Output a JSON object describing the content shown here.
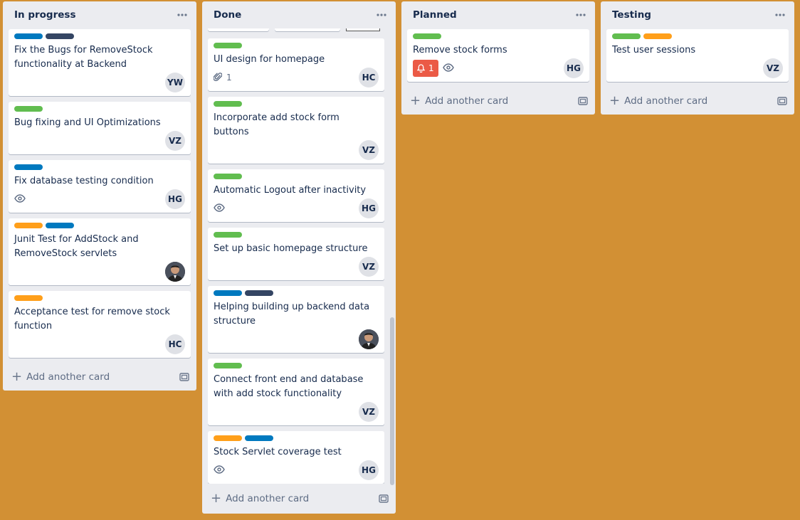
{
  "colors": {
    "board_bg": "#d29034",
    "list_bg": "#ebecf0",
    "label_blue": "#0079bf",
    "label_dark": "#344563",
    "label_green": "#61bd4f",
    "label_orange": "#ff9f1a",
    "badge_red": "#eb5a46"
  },
  "add_card_label": "Add another card",
  "lists": [
    {
      "title": "In progress",
      "cards": [
        {
          "labels": [
            "blue",
            "dark"
          ],
          "title": "Fix the Bugs for RemoveStock functionality at Backend",
          "avatar": "YW"
        },
        {
          "labels": [
            "green"
          ],
          "title": "Bug fixing and UI Optimizations",
          "avatar": "VZ"
        },
        {
          "labels": [
            "blue"
          ],
          "title": "Fix database testing condition",
          "watch": true,
          "avatar": "HG"
        },
        {
          "labels": [
            "orange",
            "blue"
          ],
          "title": "Junit Test for AddStock and RemoveStock servlets",
          "avatar_photo": true
        },
        {
          "labels": [
            "orange"
          ],
          "title": "Acceptance test for remove stock function",
          "avatar": "HC"
        }
      ]
    },
    {
      "title": "Done",
      "cards": [
        {
          "labels": [
            "green"
          ],
          "title": "UI design for homepage",
          "attachments": "1",
          "avatar": "HC"
        },
        {
          "labels": [
            "green"
          ],
          "title": "Incorporate add stock form buttons",
          "avatar": "VZ"
        },
        {
          "labels": [
            "green"
          ],
          "title": "Automatic Logout after inactivity",
          "watch": true,
          "avatar": "HG"
        },
        {
          "labels": [
            "green"
          ],
          "title": "Set up basic homepage structure",
          "avatar": "VZ"
        },
        {
          "labels": [
            "blue",
            "dark"
          ],
          "title": "Helping building up backend data structure",
          "avatar_photo": true
        },
        {
          "labels": [
            "green"
          ],
          "title": "Connect front end and database with add stock functionality",
          "avatar": "VZ"
        },
        {
          "labels": [
            "orange",
            "blue"
          ],
          "title": "Stock Servlet coverage test",
          "watch": true,
          "avatar": "HG"
        }
      ]
    },
    {
      "title": "Planned",
      "cards": [
        {
          "labels": [
            "green"
          ],
          "title": "Remove stock forms",
          "alert": "1",
          "watch": true,
          "avatar": "HG"
        }
      ]
    },
    {
      "title": "Testing",
      "cards": [
        {
          "labels": [
            "green",
            "orange"
          ],
          "title": "Test user sessions",
          "avatar": "VZ"
        }
      ]
    }
  ]
}
